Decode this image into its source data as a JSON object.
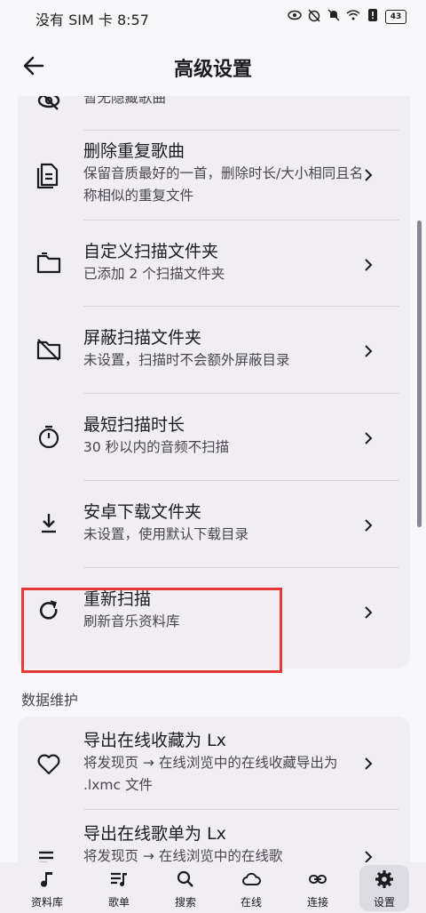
{
  "status": {
    "carrier": "没有 SIM 卡",
    "time": "8:57",
    "battery": "43"
  },
  "appbar": {
    "title": "高级设置"
  },
  "items": [
    {
      "title": "",
      "subtitle": "暂无隐藏歌曲"
    },
    {
      "title": "删除重复歌曲",
      "subtitle": "保留音质最好的一首，删除时长/大小相同且名称相似的重复文件"
    },
    {
      "title": "自定义扫描文件夹",
      "subtitle": "已添加 2 个扫描文件夹"
    },
    {
      "title": "屏蔽扫描文件夹",
      "subtitle": "未设置，扫描时不会额外屏蔽目录"
    },
    {
      "title": "最短扫描时长",
      "subtitle": "30 秒以内的音频不扫描"
    },
    {
      "title": "安卓下载文件夹",
      "subtitle": "未设置，使用默认下载目录"
    },
    {
      "title": "重新扫描",
      "subtitle": "刷新音乐资料库"
    }
  ],
  "section2": {
    "title": "数据维护"
  },
  "items2": [
    {
      "title": "导出在线收藏为 Lx",
      "subtitle": "将发现页 → 在线浏览中的在线收藏导出为 .lxmc 文件"
    },
    {
      "title": "导出在线歌单为 Lx",
      "subtitle": "将发现页 → 在线浏览中的在线歌"
    }
  ],
  "nav": [
    {
      "label": "资料库",
      "icon": "music-note-icon"
    },
    {
      "label": "歌单",
      "icon": "playlist-icon"
    },
    {
      "label": "搜索",
      "icon": "search-icon"
    },
    {
      "label": "在线",
      "icon": "cloud-icon"
    },
    {
      "label": "连接",
      "icon": "link-icon"
    },
    {
      "label": "设置",
      "icon": "gear-icon"
    }
  ],
  "colors": {
    "accent": "#e53935",
    "card": "#f0eef3",
    "background": "#f7f6f9"
  }
}
